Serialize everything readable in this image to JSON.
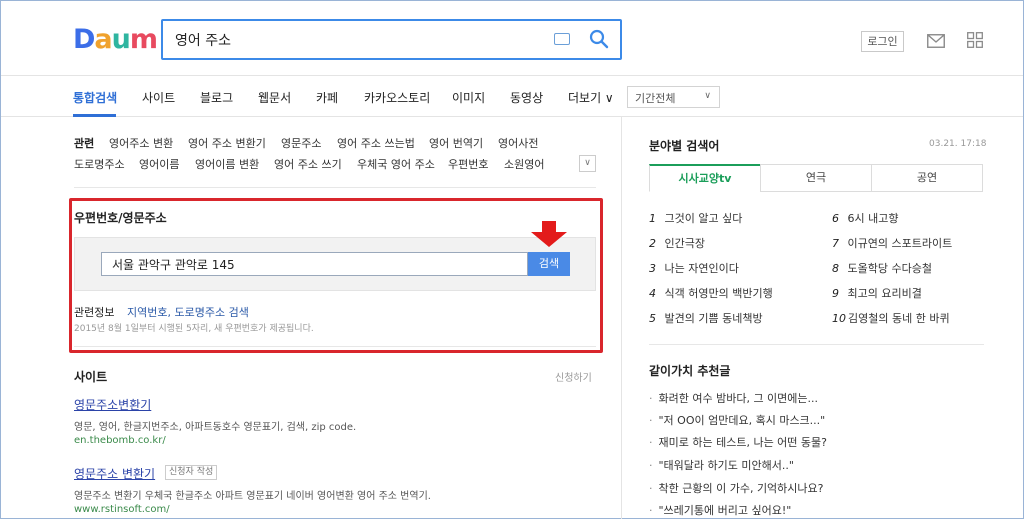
{
  "header": {
    "logo": [
      "D",
      "a",
      "u",
      "m"
    ],
    "search_value": "영어 주소",
    "login_label": "로그인"
  },
  "nav": {
    "items": [
      "통합검색",
      "사이트",
      "블로그",
      "웹문서",
      "카페",
      "카카오스토리",
      "이미지",
      "동영상",
      "더보기 ∨"
    ],
    "period": "기간전체"
  },
  "related": {
    "title": "관련",
    "row1": [
      "영어주소 변환",
      "영어 주소 변환기",
      "영문주소",
      "영어 주소 쓰는법",
      "영어 번역기",
      "영어사전"
    ],
    "row2": [
      "도로명주소",
      "영어이름",
      "영어이름 변환",
      "영어 주소 쓰기",
      "우체국 영어 주소",
      "우편번호",
      "소원영어"
    ]
  },
  "postal": {
    "title": "우편번호/영문주소",
    "input_value": "서울 관악구 관악로 145",
    "button": "검색",
    "info_label": "관련정보",
    "info_links": "지역번호, 도로명주소 검색",
    "info_desc": "2015년 8월 1일부터 시행된 5자리, 새 우편번호가 제공됩니다."
  },
  "site": {
    "title": "사이트",
    "report": "신청하기",
    "results": [
      {
        "title": "영문주소변환기",
        "desc": "영문, 영어, 한글지번주소, 아파트동호수 영문표기, 검색, zip code.",
        "url": "en.thebomb.co.kr/"
      },
      {
        "title": "영문주소 변환기",
        "tag": "신청자 작성",
        "desc": "영문주소 변환기 우체국 한글주소 아파트 영문표기 네이버 영어변환 영어 주소 번역기.",
        "url": "www.rstinsoft.com/"
      }
    ]
  },
  "right": {
    "title": "분야별 검색어",
    "date": "03.21. 17:18",
    "tabs": [
      "시사교양tv",
      "연극",
      "공연"
    ],
    "ranks_left": [
      {
        "n": "1",
        "t": "그것이 알고 싶다"
      },
      {
        "n": "2",
        "t": "인간극장"
      },
      {
        "n": "3",
        "t": "나는 자연인이다"
      },
      {
        "n": "4",
        "t": "식객 허영만의 백반기행"
      },
      {
        "n": "5",
        "t": "발견의 기쁨 동네책방"
      }
    ],
    "ranks_right": [
      {
        "n": "6",
        "t": "6시 내고향"
      },
      {
        "n": "7",
        "t": "이규연의 스포트라이트"
      },
      {
        "n": "8",
        "t": "도올학당 수다승철"
      },
      {
        "n": "9",
        "t": "최고의 요리비결"
      },
      {
        "n": "10",
        "t": "김영철의 동네 한 바퀴"
      }
    ],
    "rec_title": "같이가치 추천글",
    "rec": [
      "화려한 여수 밤바다, 그 이면에는...",
      "\"저 OO이 엄만데요, 혹시 마스크...\"",
      "재미로 하는 테스트, 나는 어떤 동물?",
      "\"태워달라 하기도 미안해서..\"",
      "착한 근황의 이 가수, 기억하시나요?",
      "\"쓰레기통에 버리고 싶어요!\""
    ]
  },
  "colors": {
    "accent": "#2f6fd6",
    "highlight": "#d9262c",
    "search_border": "#3c8ae8",
    "green": "#1b9e5a"
  }
}
